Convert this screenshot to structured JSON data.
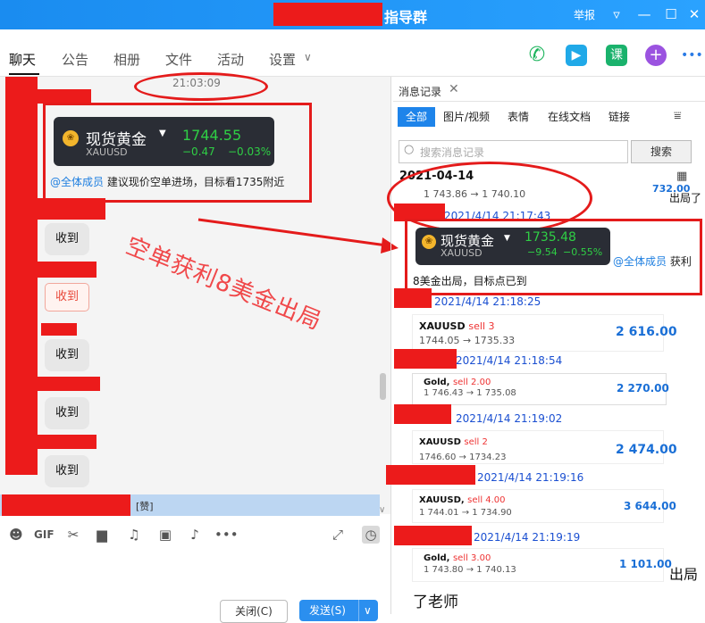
{
  "window": {
    "title_suffix": "指导群",
    "report": "举报",
    "minimize": "—",
    "restore": "☐",
    "close": "✕"
  },
  "tabs": {
    "chat": "聊天",
    "notice": "公告",
    "album": "相册",
    "files": "文件",
    "activity": "活动",
    "settings": "设置"
  },
  "top_icons": {
    "classroom": "课",
    "add": "+",
    "more": "•••"
  },
  "chat": {
    "time": "21:03:09",
    "quote": {
      "name": "现货黄金",
      "symbol": "XAUUSD",
      "price": "1744.55",
      "change": "−0.47",
      "change_pct": "−0.03%"
    },
    "mention": "@全体成员",
    "message": "建议现价空单进场，目标看1735附近",
    "received": "收到",
    "stamp": "收到",
    "overlay": "空单获利8美金出局",
    "zan": "[赞]"
  },
  "toolbar": {
    "close_label": "关闭(C)",
    "send_label": "发送(S)"
  },
  "history": {
    "tab_label": "消息记录",
    "filters": [
      "全部",
      "图片/视频",
      "表情",
      "在线文档",
      "链接"
    ],
    "search_placeholder": "搜索消息记录",
    "search_button": "搜索",
    "date": "2021-04-14",
    "first_move": "1 743.86 → 1 740.10",
    "first_cut": "732.00",
    "side_text1": "出局了",
    "ts1": "2021/4/14 21:17:43",
    "quote2": {
      "name": "现货黄金",
      "symbol": "XAUUSD",
      "price": "1735.48",
      "change": "−9.54",
      "change_pct": "−0.55%"
    },
    "mention2": "@全体成员",
    "mention2_tail": "获利",
    "msg2": "8美金出局，目标点已到",
    "ts2": "2021/4/14 21:18:25",
    "cards": [
      {
        "symbol": "XAUUSD",
        "side": "sell 3",
        "move": "1744.05 → 1735.33",
        "value": "2 616.00"
      },
      {
        "symbol": "Gold,",
        "side": "sell 2.00",
        "move": "1 746.43 → 1 735.08",
        "value": "2 270.00"
      },
      {
        "symbol": "XAUUSD",
        "side": "sell 2",
        "move": "1746.60 → 1734.23",
        "value": "2 474.00"
      },
      {
        "symbol": "XAUUSD,",
        "side": "sell 4.00",
        "move": "1 744.01 → 1 734.90",
        "value": "3 644.00"
      },
      {
        "symbol": "Gold,",
        "side": "sell 3.00",
        "move": "1 743.80 → 1 740.13",
        "value": "1 101.00"
      }
    ],
    "ts3": "2021/4/14 21:18:54",
    "ts4": "2021/4/14 21:19:02",
    "ts5": "2021/4/14 21:19:16",
    "ts6": "2021/4/14 21:19:19",
    "side_text2": "出局",
    "bottom_text": "了老师"
  },
  "colors": {
    "accent": "#2b8fef",
    "redaction": "#ec1b1b",
    "price_green": "#2fcf45"
  }
}
